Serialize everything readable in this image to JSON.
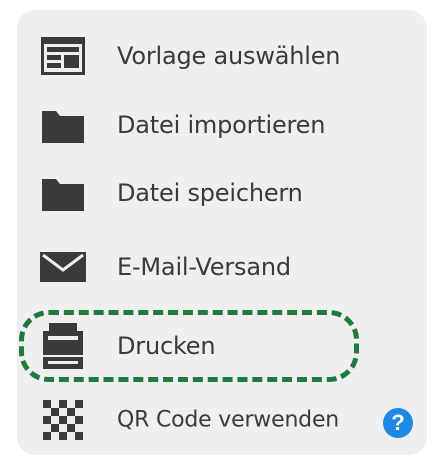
{
  "menu": {
    "items": [
      {
        "label": "Vorlage auswählen",
        "icon": "template-icon"
      },
      {
        "label": "Datei importieren",
        "icon": "folder-icon"
      },
      {
        "label": "Datei speichern",
        "icon": "folder-icon"
      },
      {
        "label": "E-Mail-Versand",
        "icon": "envelope-icon"
      },
      {
        "label": "Drucken",
        "icon": "printer-icon"
      },
      {
        "label": "QR Code verwenden",
        "icon": "qr-code-icon"
      }
    ],
    "highlighted": "Drucken"
  },
  "help": {
    "label": "?"
  },
  "colors": {
    "panel_bg": "#efefef",
    "icon": "#3a3a3a",
    "highlight": "#1f7a3c",
    "help": "#1e88e5"
  }
}
